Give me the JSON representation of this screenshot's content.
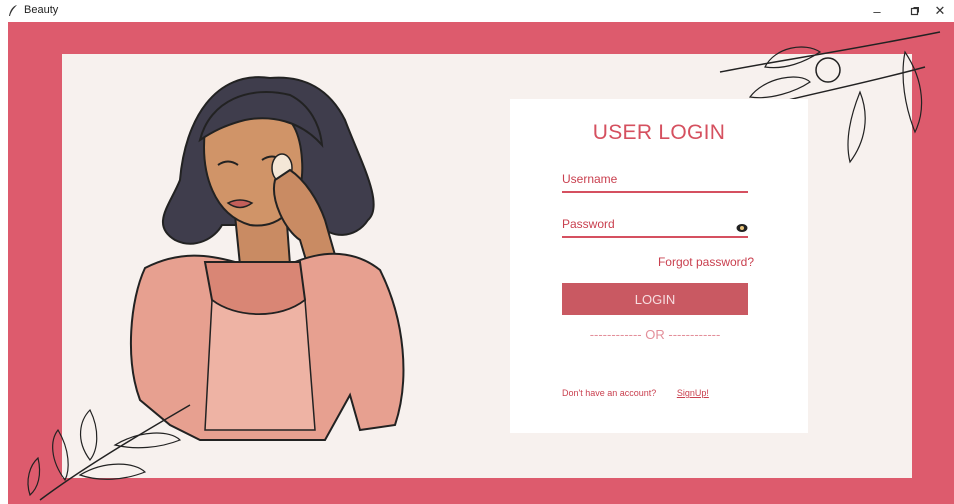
{
  "window": {
    "title": "Beauty",
    "minimize_glyph": "–",
    "restore_glyph": "▫",
    "close_glyph": "✕"
  },
  "theme": {
    "accent": "#dd5b6d",
    "background": "#f7f1ee",
    "card": "#ffffff",
    "button": "#c95962"
  },
  "login": {
    "title": "USER LOGIN",
    "username_label": "Username",
    "password_label": "Password",
    "forgot_password": "Forgot password?",
    "login_button": "LOGIN",
    "or_divider": "------------ OR ------------",
    "no_account_text": "Don't have an account?",
    "signup_link": "SignUp!"
  },
  "icons": [
    "feather-icon",
    "eye-icon",
    "branch-decoration",
    "woman-illustration"
  ]
}
